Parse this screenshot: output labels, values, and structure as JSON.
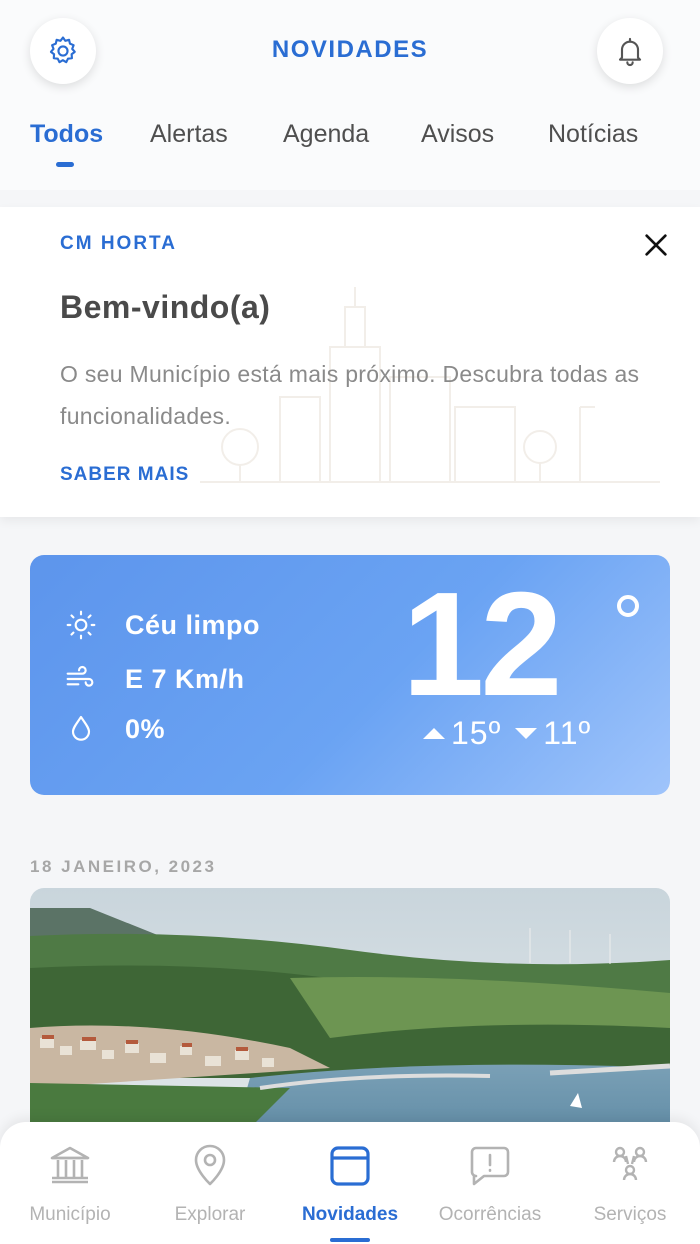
{
  "header": {
    "title": "NOVIDADES",
    "left_icon": "gear-icon",
    "right_icon": "bell-icon",
    "accent_color": "#2a6dd3"
  },
  "tabs": [
    {
      "label": "Todos",
      "active": true
    },
    {
      "label": "Alertas",
      "active": false
    },
    {
      "label": "Agenda",
      "active": false
    },
    {
      "label": "Avisos",
      "active": false
    },
    {
      "label": "Notícias",
      "active": false
    }
  ],
  "welcome_card": {
    "org": "CM HORTA",
    "title": "Bem-vindo(a)",
    "text": "O seu Município está mais próximo. Descubra todas as funcionalidades.",
    "link": "SABER MAIS",
    "close_icon": "close-icon"
  },
  "weather": {
    "condition": "Céu limpo",
    "wind": "E 7 Km/h",
    "precipitation": "0%",
    "temperature": "12",
    "max": "15º",
    "min": "11º",
    "icons": [
      "sun-icon",
      "wind-icon",
      "drop-icon"
    ]
  },
  "news": {
    "date": "18 JANEIRO, 2023",
    "image": "landscape-photo"
  },
  "bottom_nav": [
    {
      "label": "Município",
      "icon": "bank-icon",
      "active": false
    },
    {
      "label": "Explorar",
      "icon": "map-pin-icon",
      "active": false
    },
    {
      "label": "Novidades",
      "icon": "news-card-icon",
      "active": true
    },
    {
      "label": "Ocorrências",
      "icon": "alert-chat-icon",
      "active": false
    },
    {
      "label": "Serviços",
      "icon": "people-icon",
      "active": false
    }
  ]
}
